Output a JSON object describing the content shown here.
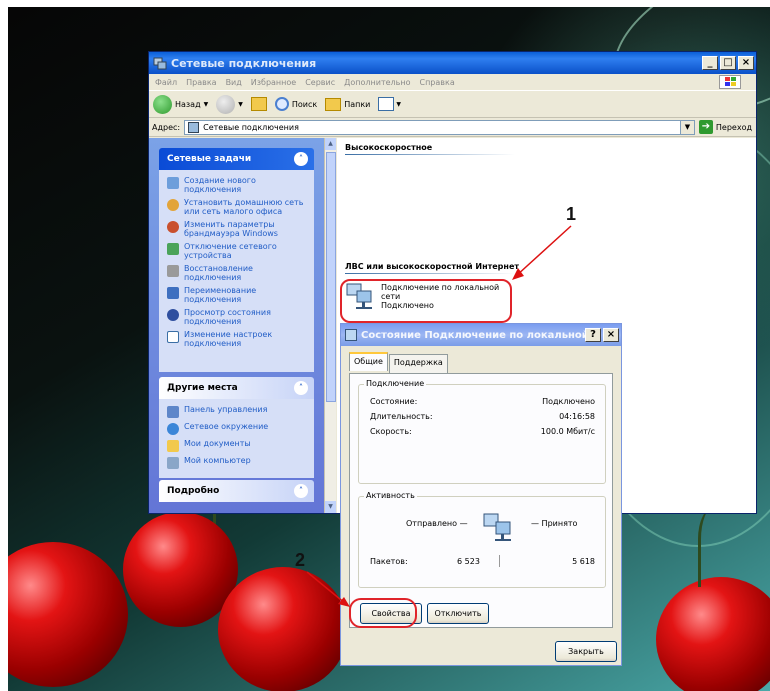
{
  "explorer": {
    "title": "Сетевые подключения",
    "menu": [
      "Файл",
      "Правка",
      "Вид",
      "Избранное",
      "Сервис",
      "Дополнительно",
      "Справка"
    ],
    "toolbar": {
      "back": "Назад",
      "search": "Поиск",
      "folders": "Папки"
    },
    "address": {
      "label": "Адрес:",
      "value": "Сетевые подключения",
      "go": "Переход"
    },
    "network_tasks": {
      "title": "Сетевые задачи",
      "items": [
        "Создание нового подключения",
        "Установить домашнюю сеть или сеть малого офиса",
        "Изменить параметры брандмауэра Windows",
        "Отключение сетевого устройства",
        "Восстановление подключения",
        "Переименование подключения",
        "Просмотр состояния подключения",
        "Изменение настроек подключения"
      ]
    },
    "other_places": {
      "title": "Другие места",
      "items": [
        "Панель управления",
        "Сетевое окружение",
        "Мои документы",
        "Мой компьютер"
      ]
    },
    "details": {
      "title": "Подробно"
    },
    "groups": {
      "highspeed": "Высокоскоростное",
      "lan": "ЛВС или высокоскоростной Интернет"
    },
    "connection": {
      "name_line1": "Подключение по локальной",
      "name_line2": "сети",
      "status": "Подключено"
    }
  },
  "dialog": {
    "title": "Состояние Подключение по локальной сети",
    "tabs": [
      "Общие",
      "Поддержка"
    ],
    "connection_group": {
      "label": "Подключение",
      "rows": [
        {
          "label": "Состояние:",
          "value": "Подключено"
        },
        {
          "label": "Длительность:",
          "value": "04:16:58"
        },
        {
          "label": "Скорость:",
          "value": "100.0 Мбит/с"
        }
      ]
    },
    "activity_group": {
      "label": "Активность",
      "sent": "Отправлено",
      "received": "Принято",
      "packets_label": "Пакетов:",
      "packets_sent": "6 523",
      "packets_received": "5 618"
    },
    "buttons": {
      "properties": "Свойства",
      "disable": "Отключить",
      "close": "Закрыть"
    }
  },
  "callouts": {
    "one": "1",
    "two": "2"
  },
  "colors": {
    "xp_blue": "#0a50c8",
    "task_link": "#215dc6",
    "highlight": "#e0242a"
  }
}
